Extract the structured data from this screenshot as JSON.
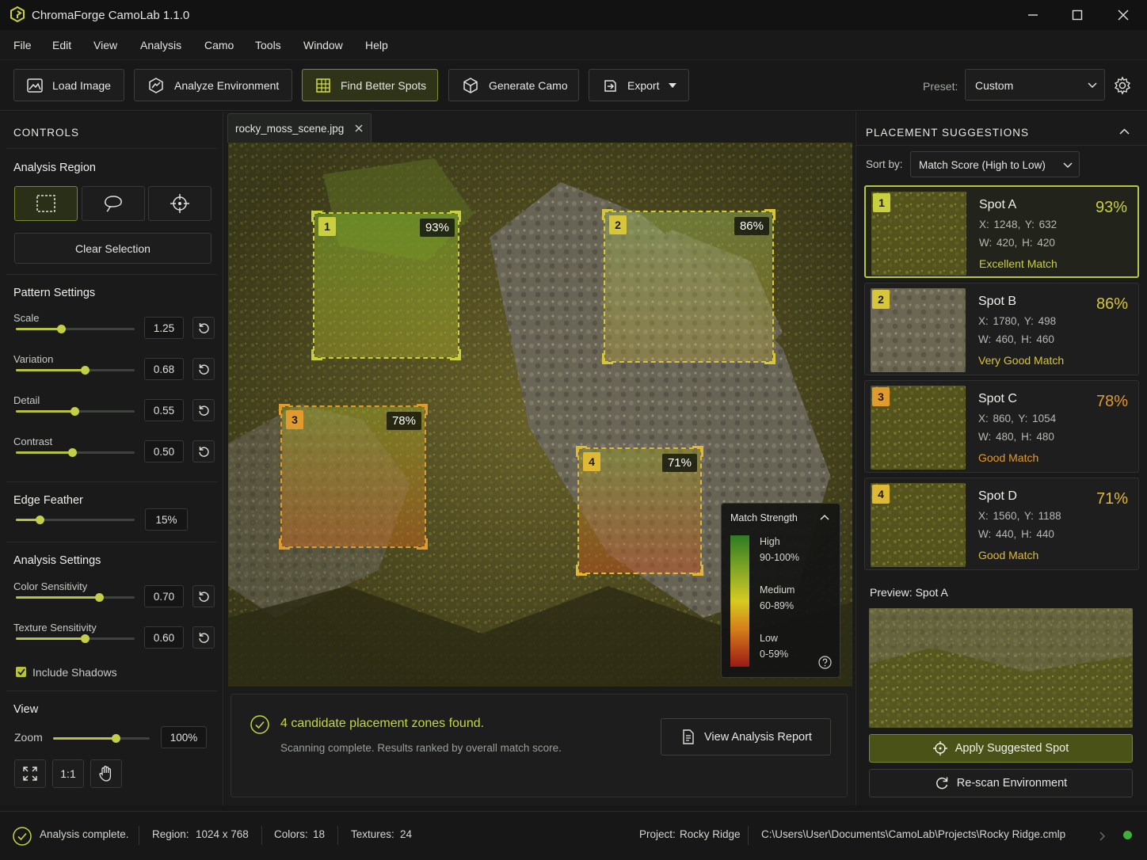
{
  "window": {
    "title": "ChromaForge CamoLab 1.1.0"
  },
  "menu": [
    "File",
    "Edit",
    "View",
    "Analysis",
    "Camo",
    "Tools",
    "Window",
    "Help"
  ],
  "toolbar": {
    "load_image": "Load Image",
    "analyze_environment": "Analyze Environment",
    "find_better_spots": "Find Better Spots",
    "generate_camo": "Generate Camo",
    "export": "Export",
    "preset_label": "Preset:",
    "preset_value": "Custom"
  },
  "controls": {
    "header": "CONTROLS",
    "analysis_region": {
      "title": "Analysis Region",
      "tools": [
        "rectangle-select-icon",
        "lasso-select-icon",
        "crosshair-select-icon"
      ],
      "clear_label": "Clear Selection"
    },
    "pattern_settings": {
      "title": "Pattern Settings",
      "sliders": [
        {
          "label": "Scale",
          "value": "1.25",
          "fraction": 0.38
        },
        {
          "label": "Variation",
          "value": "0.68",
          "fraction": 0.58
        },
        {
          "label": "Detail",
          "value": "0.55",
          "fraction": 0.49
        },
        {
          "label": "Contrast",
          "value": "0.50",
          "fraction": 0.47
        }
      ]
    },
    "edge_feather": {
      "title": "Edge Feather",
      "value": "15%",
      "fraction": 0.2
    },
    "analysis_settings": {
      "title": "Analysis Settings",
      "sliders": [
        {
          "label": "Color Sensitivity",
          "value": "0.70",
          "fraction": 0.7
        },
        {
          "label": "Texture Sensitivity",
          "value": "0.60",
          "fraction": 0.58
        }
      ],
      "include_shadows": {
        "label": "Include Shadows",
        "checked": true
      }
    },
    "view": {
      "title": "View",
      "zoom_label": "Zoom",
      "zoom_value": "100%",
      "zoom_fraction": 0.65,
      "one_to_one": "1:1"
    }
  },
  "canvas": {
    "tab_name": "rocky_moss_scene.jpg",
    "zones": [
      {
        "num": "1",
        "score": "93%",
        "color": "#c9cf3e"
      },
      {
        "num": "2",
        "score": "86%",
        "color": "#d8c63a"
      },
      {
        "num": "3",
        "score": "78%",
        "color": "#e19a2e"
      },
      {
        "num": "4",
        "score": "71%",
        "color": "#e0b934"
      }
    ],
    "legend": {
      "title": "Match Strength",
      "levels": [
        {
          "name": "High",
          "range": "90-100%"
        },
        {
          "name": "Medium",
          "range": "60-89%"
        },
        {
          "name": "Low",
          "range": "0-59%"
        }
      ]
    }
  },
  "result": {
    "headline": "4 candidate placement zones found.",
    "subtext": "Scanning complete. Results ranked by overall match score.",
    "report_button": "View Analysis Report"
  },
  "suggestions": {
    "header": "PLACEMENT SUGGESTIONS",
    "sort_label": "Sort by:",
    "sort_value": "Match Score (High to Low)",
    "spots": [
      {
        "num": "1",
        "name": "Spot A",
        "x": "1248,",
        "y": "632",
        "w": "420,",
        "h": "420",
        "quality": "Excellent Match",
        "score": "93%",
        "color": "#c9cf3e"
      },
      {
        "num": "2",
        "name": "Spot B",
        "x": "1780,",
        "y": "498",
        "w": "460,",
        "h": "460",
        "quality": "Very Good Match",
        "score": "86%",
        "color": "#d8c63a"
      },
      {
        "num": "3",
        "name": "Spot C",
        "x": "860,",
        "y": "1054",
        "w": "480,",
        "h": "480",
        "quality": "Good Match",
        "score": "78%",
        "color": "#e19a2e"
      },
      {
        "num": "4",
        "name": "Spot D",
        "x": "1560,",
        "y": "1188",
        "w": "440,",
        "h": "440",
        "quality": "Good Match",
        "score": "71%",
        "color": "#e0b934"
      }
    ],
    "coord_labels": {
      "x": "X:",
      "y": "Y:",
      "w": "W:",
      "h": "H:"
    },
    "preview_label": "Preview: Spot A",
    "apply_button": "Apply Suggested Spot",
    "rescan_button": "Re-scan Environment"
  },
  "status": {
    "state": "Analysis complete.",
    "region_label": "Region:",
    "region_value": "1024 x 768",
    "colors_label": "Colors:",
    "colors_value": "18",
    "textures_label": "Textures:",
    "textures_value": "24",
    "project_label": "Project:",
    "project_value": "Rocky Ridge",
    "path": "C:\\Users\\User\\Documents\\CamoLab\\Projects\\Rocky Ridge.cmlp"
  }
}
